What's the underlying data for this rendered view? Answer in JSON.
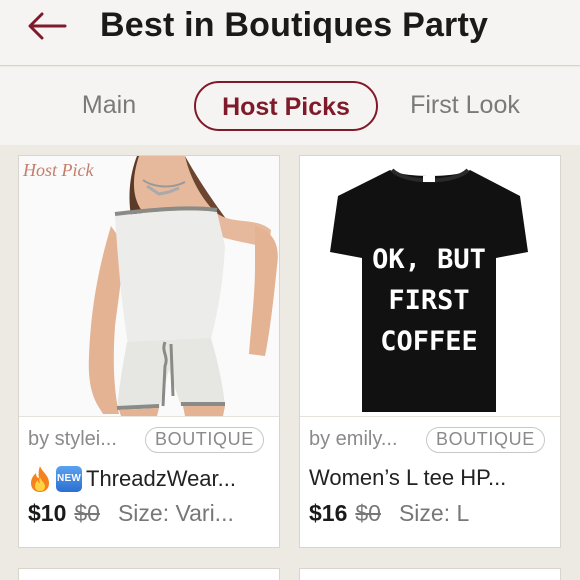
{
  "header": {
    "title": "Best in Boutiques Party",
    "back_icon": "arrow-left-icon",
    "accent_color": "#7f1a2a"
  },
  "tabs": [
    {
      "label": "Main",
      "active": false
    },
    {
      "label": "Host Picks",
      "active": true
    },
    {
      "label": "First Look",
      "active": false
    }
  ],
  "listings": [
    {
      "seller": "by stylei...",
      "badge": "BOUTIQUE",
      "title": "ThreadzWear...",
      "title_icons": [
        "fire-icon",
        "new-icon"
      ],
      "new_icon_text": "NEW",
      "price": "$10",
      "original_price": "$0",
      "size": "Size: Vari...",
      "image_watermark": "Host Pick"
    },
    {
      "seller": "by emily...",
      "badge": "BOUTIQUE",
      "title": "Women’s L tee HP...",
      "price": "$16",
      "original_price": "$0",
      "size": "Size: L",
      "shirt_text": [
        "OK, BUT",
        "FIRST",
        "COFFEE"
      ]
    }
  ]
}
